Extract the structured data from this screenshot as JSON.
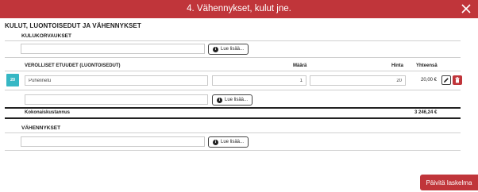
{
  "dialog": {
    "title": "4. Vähennykset, kulut jne.",
    "section_title": "KULUT, LUONTOISEDUT JA VÄHENNYKSET"
  },
  "kulukorvaukset": {
    "label": "KULUKORVAUKSET",
    "input_value": "",
    "read_more": "Lue lisää..."
  },
  "verolliset": {
    "label": "VEROLLISET ETUUDET (LUONTOISEDUT)",
    "col_maara": "Määrä",
    "col_hinta": "Hinta",
    "col_yhteensa": "Yhteensä",
    "row": {
      "code": "20",
      "name": "Puhelinetu",
      "maara": "1",
      "hinta": "20",
      "yhteensa": "20,00 €"
    },
    "new_input_value": "",
    "read_more": "Lue lisää..."
  },
  "summary": {
    "label": "Kokonaiskustannus",
    "value": "3 246,24 €"
  },
  "vahennykset": {
    "label": "VÄHENNYKSET",
    "input_value": "",
    "read_more": "Lue lisää..."
  },
  "footer": {
    "update_button": "Päivitä laskelma"
  },
  "colors": {
    "accent": "#c0353a",
    "badge": "#36b7c4"
  }
}
